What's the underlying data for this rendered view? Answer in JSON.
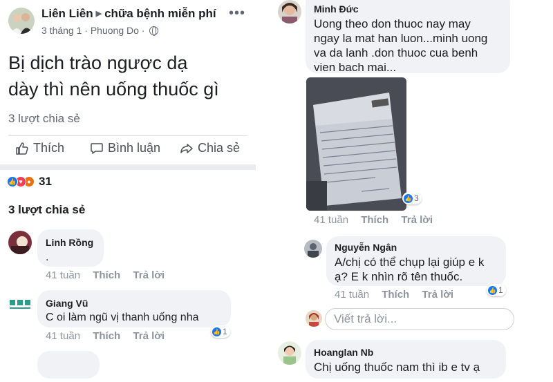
{
  "post": {
    "author": "Liên Liên",
    "group": "chữa bệnh miễn phí",
    "time": "3 tháng 1",
    "location": "Phuong Do",
    "text_line1": "Bị dịch trào ngược dạ",
    "text_line2": "dày thì nên uống thuốc gì",
    "share_count": "3 lượt chia sẻ",
    "actions": {
      "like": "Thích",
      "comment": "Bình luận",
      "share": "Chia sẻ"
    },
    "reaction_count": "31",
    "reaction_icons": [
      "like-icon",
      "love-icon",
      "angry-icon"
    ],
    "shares_heading": "3 lượt chia sẻ"
  },
  "comments_left": [
    {
      "name": "Linh Rồng",
      "text": ".",
      "time": "41 tuần",
      "like": "Thích",
      "reply": "Trả lời"
    },
    {
      "name": "Giang Vũ",
      "text": "C oi làm ngũ vị thanh uống nha",
      "time": "41 tuần",
      "like": "Thích",
      "reply": "Trả lời",
      "likes": "1"
    }
  ],
  "comments_right": [
    {
      "name": "Minh Đức",
      "text_lines": [
        "Uong theo don thuoc nay may",
        "ngay la mat han luon...minh uong",
        "va da lanh .don thuoc cua benh",
        "vien bach mai..."
      ],
      "time": "41 tuần",
      "like": "Thích",
      "reply": "Trả lời",
      "likes": "3"
    },
    {
      "name": "Nguyễn Ngân",
      "text_lines": [
        "A/chị có thể chụp lại giúp e k",
        "ạ? E k nhìn rõ tên thuốc."
      ],
      "time": "41 tuần",
      "like": "Thích",
      "reply": "Trả lời",
      "likes": "1"
    },
    {
      "name": "Hoanglan Nb",
      "text_lines": [
        "Chị uống thuốc nam thì ib e tv ạ"
      ]
    }
  ],
  "reply_placeholder": "Viết trả lời...",
  "colors": {
    "brand_blue": "#1877f2",
    "bubble_bg": "#f0f2f5",
    "meta_grey": "#8d949e",
    "love": "#f33e58",
    "angry": "#e9710f"
  }
}
